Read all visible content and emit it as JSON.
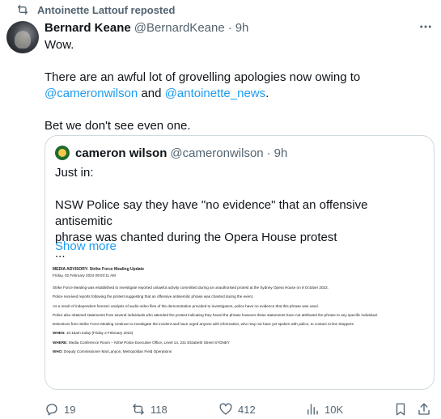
{
  "repost": {
    "text": "Antoinette Lattouf reposted",
    "icon": "repost-icon"
  },
  "tweet": {
    "author_name": "Bernard Keane",
    "handle": "@BernardKeane",
    "separator": "·",
    "time": "9h",
    "line1": "Wow.",
    "line2_pre": "There are an awful lot of grovelling apologies now owing to",
    "mention1": "@cameronwilson",
    "and_text": " and ",
    "mention2": "@antoinette_news",
    "period": ".",
    "line3": "Bet we don't see even one."
  },
  "quote": {
    "author_name": "cameron wilson",
    "handle": "@cameronwilson",
    "separator": "·",
    "time": "9h",
    "line1": "Just in:",
    "line2": "NSW Police say they have \"no evidence\" that an offensive antisemitic",
    "line3": "phrase was chanted during the Opera House protest",
    "ellipsis": "...",
    "show_more": "Show more"
  },
  "advisory": {
    "title": "MEDIA ADVISORY: Strike Force Mealing Update",
    "date": "Friday, 02 February 2024 09:03:11 AM",
    "p1": "Strike Force Mealing was established to investigate reported unlawful activity committed during an unauthorised protest at the Sydney Opera House on 9 October 2023.",
    "p2": "Police received reports following the protest suggesting that an offensive antisemitic phrase was chanted during the event.",
    "p3": "As a result of independent forensic analysis of audio-video files of the demonstration provided to investigators, police have no evidence that this phrase was used.",
    "p4": "Police also obtained statements from several individuals who attended the protest indicating they heard the phrase however these statements have not attributed the phrase to any specific individual.",
    "p5": "Detectives from Strike Force Mealing continue to investigate the incident and have urged anyone with information, who may not have yet spoken with police, to contact Crime Stoppers.",
    "when_label": "WHEN:",
    "when_value": " 10:15am today (Friday 2 February 2024)",
    "where_label": "WHERE:",
    "where_value": " Media Conference Room – NSW Police Executive Office, Level 14, 231 Elizabeth Street SYDNEY",
    "who_label": "WHO:",
    "who_value": " Deputy Commissioner Mal Lanyon, Metropolitan Field Operations"
  },
  "actions": {
    "replies": "19",
    "reposts": "118",
    "likes": "412",
    "views": "10K"
  },
  "colors": {
    "accent": "#1d9bf0",
    "muted": "#536471",
    "text": "#0f1419",
    "border": "#cfd9de"
  }
}
